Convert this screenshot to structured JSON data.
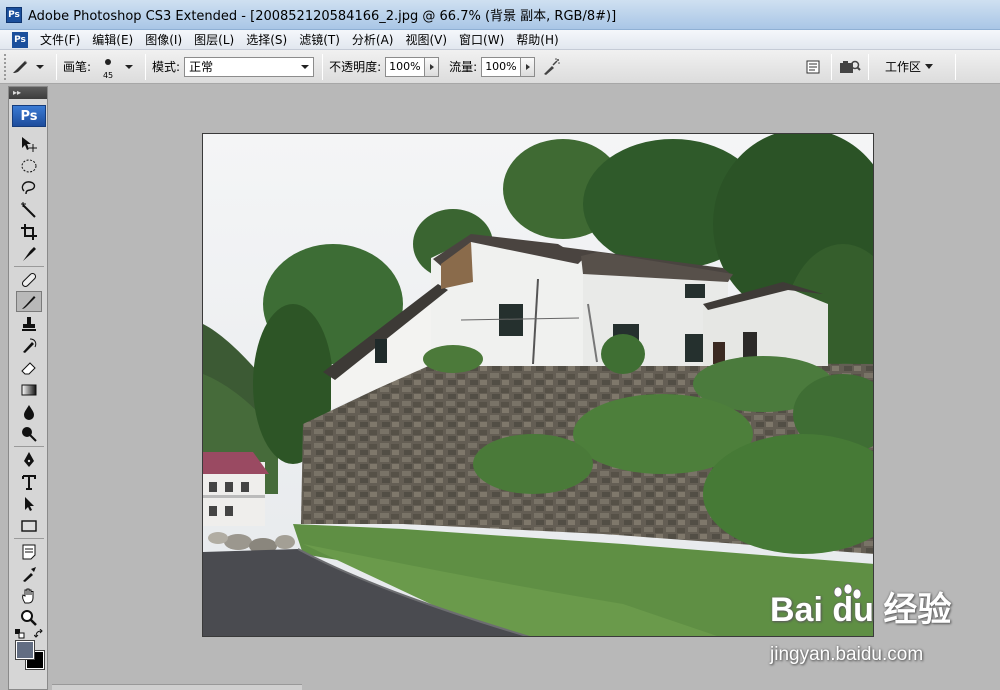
{
  "window": {
    "title": "Adobe Photoshop CS3 Extended - [200852120584166_2.jpg @ 66.7% (背景 副本, RGB/8#)]",
    "app_badge": "Ps"
  },
  "menu": {
    "items": [
      "文件(F)",
      "编辑(E)",
      "图像(I)",
      "图层(L)",
      "选择(S)",
      "滤镜(T)",
      "分析(A)",
      "视图(V)",
      "窗口(W)",
      "帮助(H)"
    ]
  },
  "options": {
    "brush_label": "画笔:",
    "brush_size": "45",
    "mode_label": "模式:",
    "mode_value": "正常",
    "opacity_label": "不透明度:",
    "opacity_value": "100%",
    "flow_label": "流量:",
    "flow_value": "100%",
    "workspace_label": "工作区"
  },
  "toolbox": {
    "logo": "Ps",
    "collapse_glyph": "▸▸",
    "foreground_color": "#626d82",
    "background_color": "#000000"
  },
  "watermark": {
    "brand": "Bai du 经验",
    "url": "jingyan.baidu.com"
  }
}
